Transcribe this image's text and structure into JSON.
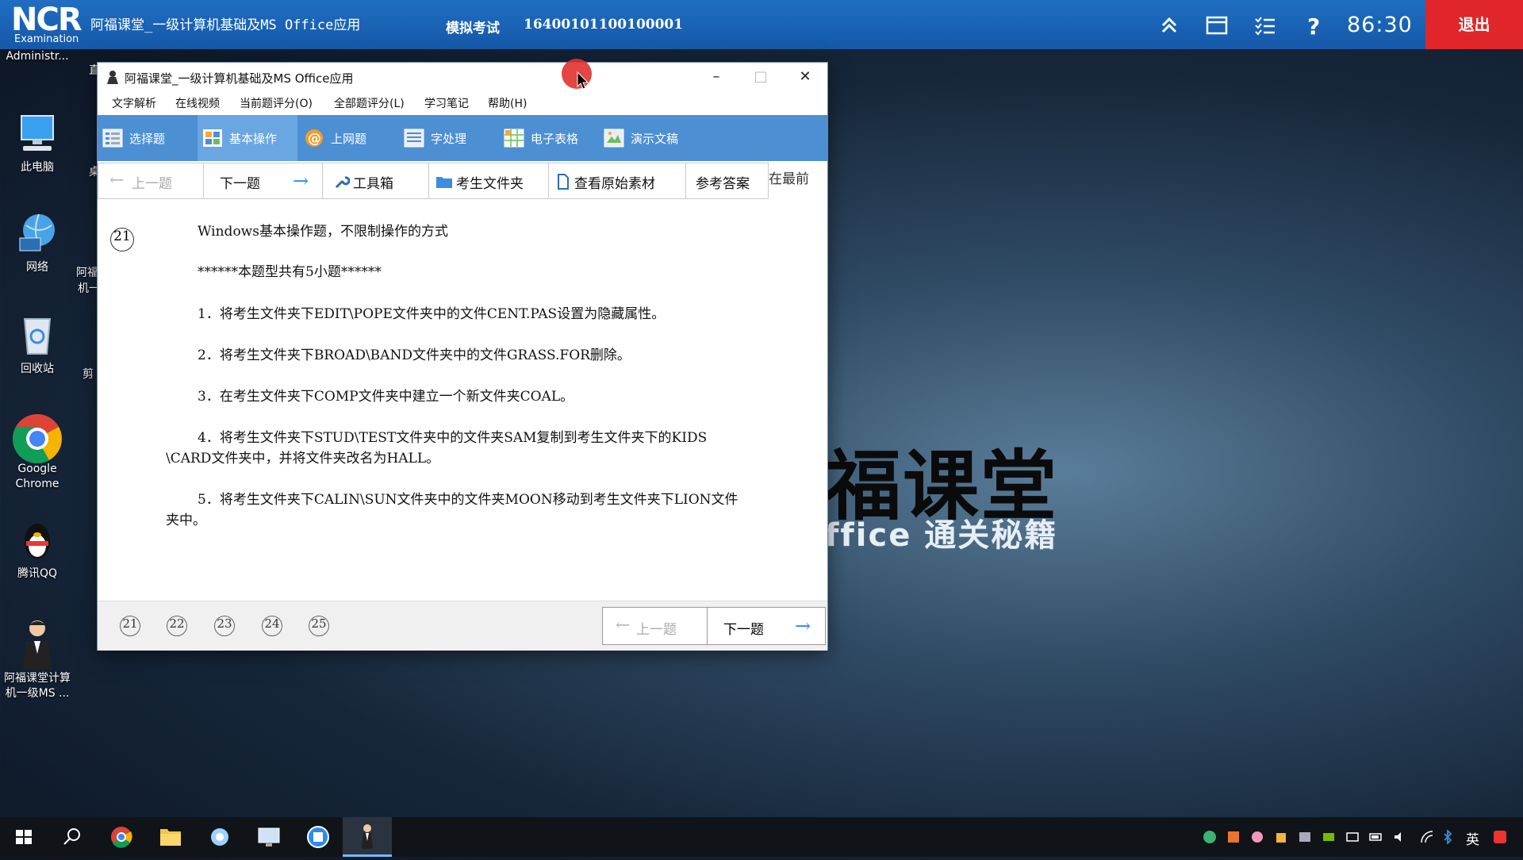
{
  "exam_bar": {
    "logo_text": "NCR",
    "logo_sub": "Examination",
    "app_title": "阿福课堂_一级计算机基础及MS Office应用",
    "mode": "模拟考试",
    "exam_id": "16400101100100001",
    "timer": "86:30",
    "exit_label": "退出"
  },
  "desktop": {
    "icons": [
      {
        "label": "Administr..."
      },
      {
        "label": "此电脑"
      },
      {
        "label": "网络"
      },
      {
        "label": "回收站"
      },
      {
        "label": "Google Chrome"
      },
      {
        "label": "腾讯QQ"
      },
      {
        "label": "阿福课堂计算机一级MS ..."
      }
    ],
    "partial_labels": [
      "直",
      "桌",
      "阿福",
      "机一",
      "剪"
    ],
    "wallpaper_title": "福课堂",
    "wallpaper_sub": "ffice 通关秘籍"
  },
  "window": {
    "title": "阿福课堂_一级计算机基础及MS Office应用",
    "menu": [
      "文字解析",
      "在线视频",
      "当前题评分(O)",
      "全部题评分(L)",
      "学习笔记",
      "帮助(H)"
    ],
    "categories": [
      "选择题",
      "基本操作",
      "上网题",
      "字处理",
      "电子表格",
      "演示文稿"
    ],
    "tools": {
      "prev": "上一题",
      "next": "下一题",
      "toolbox": "工具箱",
      "student_folder": "考生文件夹",
      "view_material": "查看原始素材",
      "reference_answer": "参考答案",
      "always_front": "在最前"
    },
    "question": {
      "number": "21",
      "lines": [
        "Windows基本操作题，不限制操作的方式",
        "******本题型共有5小题******",
        "1．将考生文件夹下EDIT\\POPE文件夹中的文件CENT.PAS设置为隐藏属性。",
        "2．将考生文件夹下BROAD\\BAND文件夹中的文件GRASS.FOR删除。",
        "3．在考生文件夹下COMP文件夹中建立一个新文件夹COAL。",
        "4．将考生文件夹下STUD\\TEST文件夹中的文件夹SAM复制到考生文件夹下的KIDS",
        "\\CARD文件夹中，并将文件夹改名为HALL。",
        "5．将考生文件夹下CALIN\\SUN文件夹中的文件夹MOON移动到考生文件夹下LION文件",
        "夹中。"
      ]
    },
    "pages": [
      "21",
      "22",
      "23",
      "24",
      "25"
    ],
    "bottom_prev": "上一题",
    "bottom_next": "下一题"
  },
  "taskbar": {
    "lang": "英"
  }
}
